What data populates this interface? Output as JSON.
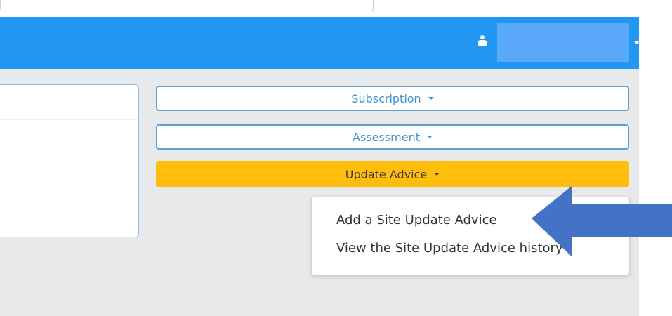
{
  "navbar": {
    "user_name": "",
    "accent": "#2196f3"
  },
  "menu": {
    "subscription_label": "Subscription",
    "assessment_label": "Assessment",
    "update_advice_label": "Update Advice",
    "update_advice_color": "#ffbe0b"
  },
  "dropdown": {
    "items": [
      {
        "label": "Add a Site Update Advice"
      },
      {
        "label": "View the Site Update Advice history"
      }
    ]
  },
  "annotation": {
    "arrow_color": "#4472c4",
    "arrow_direction": "left"
  }
}
